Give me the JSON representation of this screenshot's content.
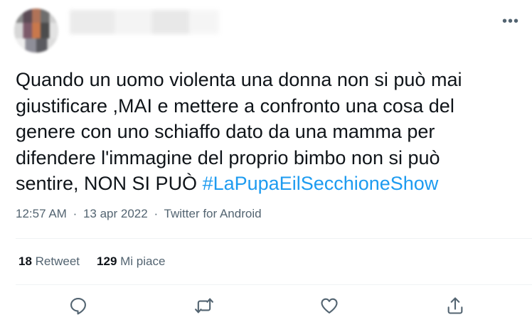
{
  "tweet": {
    "more_label": "•••",
    "text_main": "Quando un uomo violenta una donna non si può mai\ngiustificare ,MAI e mettere a confronto una cosa del\ngenere con uno schiaffo dato da una mamma per\ndifendere l'immagine del proprio bimbo non si può\nsentire, NON SI PUÒ ",
    "hashtag": "#LaPupaEilSecchioneShow",
    "time": "12:57 AM",
    "separator1": "·",
    "date": "13 apr 2022",
    "separator2": "·",
    "source": "Twitter for Android",
    "retweets_count": "18",
    "retweets_label": "Retweet",
    "likes_count": "129",
    "likes_label": "Mi piace"
  },
  "icons": {
    "reply": "reply-icon",
    "retweet": "retweet-icon",
    "like": "heart-icon",
    "share": "share-icon"
  },
  "colors": {
    "text": "#0f1419",
    "secondary": "#536471",
    "link": "#1d9bf0",
    "divider": "#eff3f4"
  }
}
